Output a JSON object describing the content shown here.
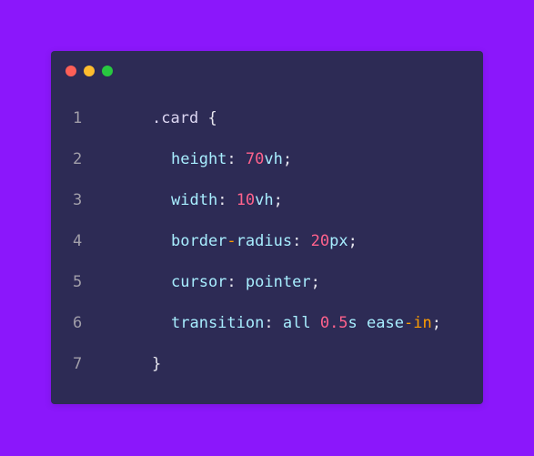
{
  "window": {
    "controls": {
      "close_color": "#fe5f57",
      "minimize_color": "#febc2e",
      "maximize_color": "#28c840"
    }
  },
  "code": {
    "lines": [
      {
        "number": "1",
        "selector": ".card",
        "open": "{"
      },
      {
        "number": "2",
        "property": "height",
        "colon": ":",
        "value_num": "70",
        "value_unit": "vh",
        "semicolon": ";"
      },
      {
        "number": "3",
        "property": "width",
        "colon": ":",
        "value_num": "10",
        "value_unit": "vh",
        "semicolon": ";"
      },
      {
        "number": "4",
        "property_a": "border",
        "property_dash": "-",
        "property_b": "radius",
        "colon": ":",
        "value_num": "20",
        "value_unit": "px",
        "semicolon": ";"
      },
      {
        "number": "5",
        "property": "cursor",
        "colon": ":",
        "value": "pointer",
        "semicolon": ";"
      },
      {
        "number": "6",
        "property": "transition",
        "colon": ":",
        "value_all": "all",
        "value_num": "0.5",
        "value_unit": "s",
        "value_ease": "ease",
        "value_dash": "-",
        "value_in": "in",
        "semicolon": ";"
      },
      {
        "number": "7",
        "close": "}"
      }
    ]
  }
}
